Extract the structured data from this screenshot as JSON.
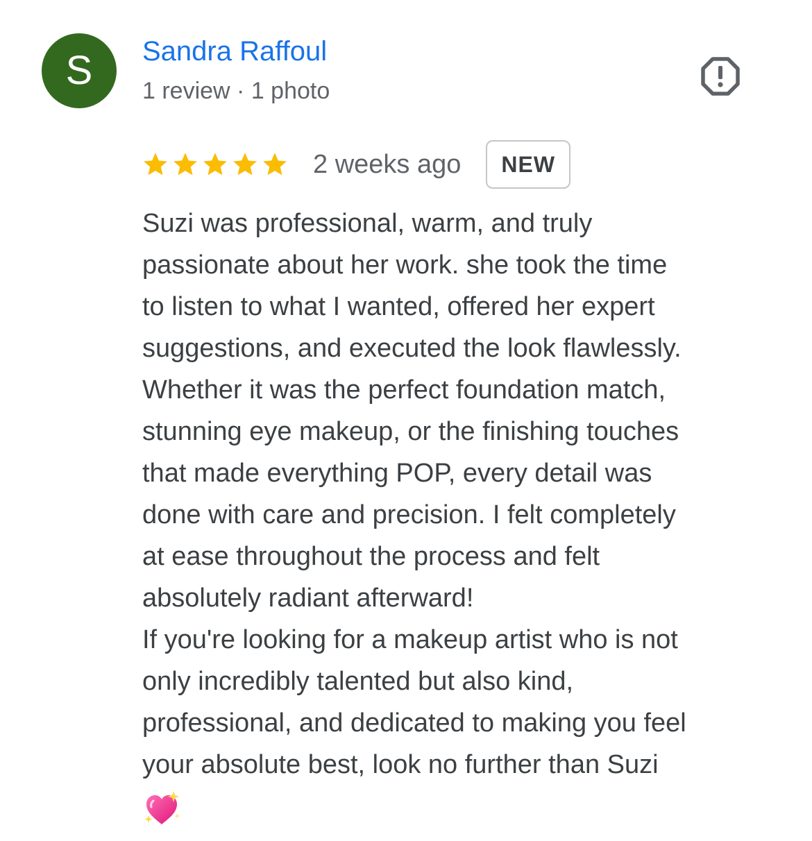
{
  "reviewer": {
    "initial": "S",
    "avatar_color": "#33691e",
    "name": "Sandra Raffoul",
    "meta": "1 review · 1 photo"
  },
  "report": {
    "icon": "report-flag-icon"
  },
  "rating": {
    "stars": 5,
    "max_stars": 5,
    "star_color": "#fbbc04"
  },
  "review": {
    "date": "2 weeks ago",
    "badge": "NEW",
    "lines": [
      "Suzi was professional, warm, and truly",
      "passionate about her work. she took the time",
      "to listen to what I wanted, offered her expert",
      "suggestions, and executed the look flawlessly.",
      "Whether it was the perfect foundation match,",
      "stunning eye makeup, or the finishing touches",
      "that made everything POP, every detail was",
      "done with care and precision. I felt completely",
      "at ease throughout the process and felt",
      "absolutely radiant afterward!",
      "If you're looking for a makeup artist who is not",
      "only incredibly talented but also kind,",
      "professional, and dedicated to making you feel",
      "your absolute best, look no further than Suzi"
    ],
    "trailing_emoji": "sparkling-heart-icon"
  }
}
